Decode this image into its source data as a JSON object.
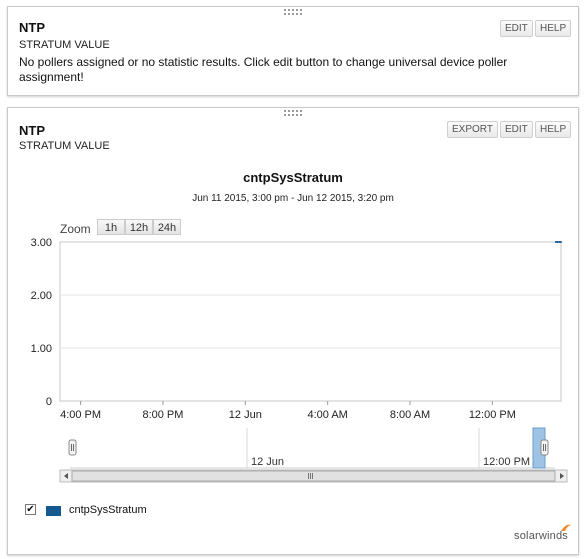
{
  "panel1": {
    "title": "NTP",
    "subtitle": "STRATUM VALUE",
    "edit": "EDIT",
    "help": "HELP",
    "message": "No pollers assigned or no statistic results. Click edit button to change universal device poller assignment!"
  },
  "panel2": {
    "title": "NTP",
    "subtitle": "STRATUM VALUE",
    "export": "EXPORT",
    "edit": "EDIT",
    "help": "HELP",
    "zoom_label": "Zoom",
    "zoom_options": [
      "1h",
      "12h",
      "24h"
    ],
    "legend_label": "cntpSysStratum",
    "legend_checked": true,
    "legend_color": "#155a8e",
    "brand": "solarwinds"
  },
  "chart_data": {
    "type": "line",
    "title": "cntpSysStratum",
    "subtitle": "Jun 11 2015, 3:00 pm - Jun 12 2015, 3:20 pm",
    "xlabel": "",
    "ylabel": "",
    "y_ticks": [
      "0",
      "1.00",
      "2.00",
      "3.00"
    ],
    "ylim": [
      0,
      3
    ],
    "x_ticks": [
      "4:00 PM",
      "8:00 PM",
      "12 Jun",
      "4:00 AM",
      "8:00 AM",
      "12:00 PM"
    ],
    "navigator_ticks": [
      "12 Jun",
      "12:00 PM"
    ],
    "series": [
      {
        "name": "cntpSysStratum",
        "color": "#155a8e",
        "points": [
          {
            "x": "3:05 PM",
            "y": 3
          },
          {
            "x": "3:10 PM",
            "y": 3
          },
          {
            "x": "3:15 PM",
            "y": 3
          },
          {
            "x": "3:20 PM",
            "y": 3
          }
        ]
      }
    ],
    "grid": true
  }
}
